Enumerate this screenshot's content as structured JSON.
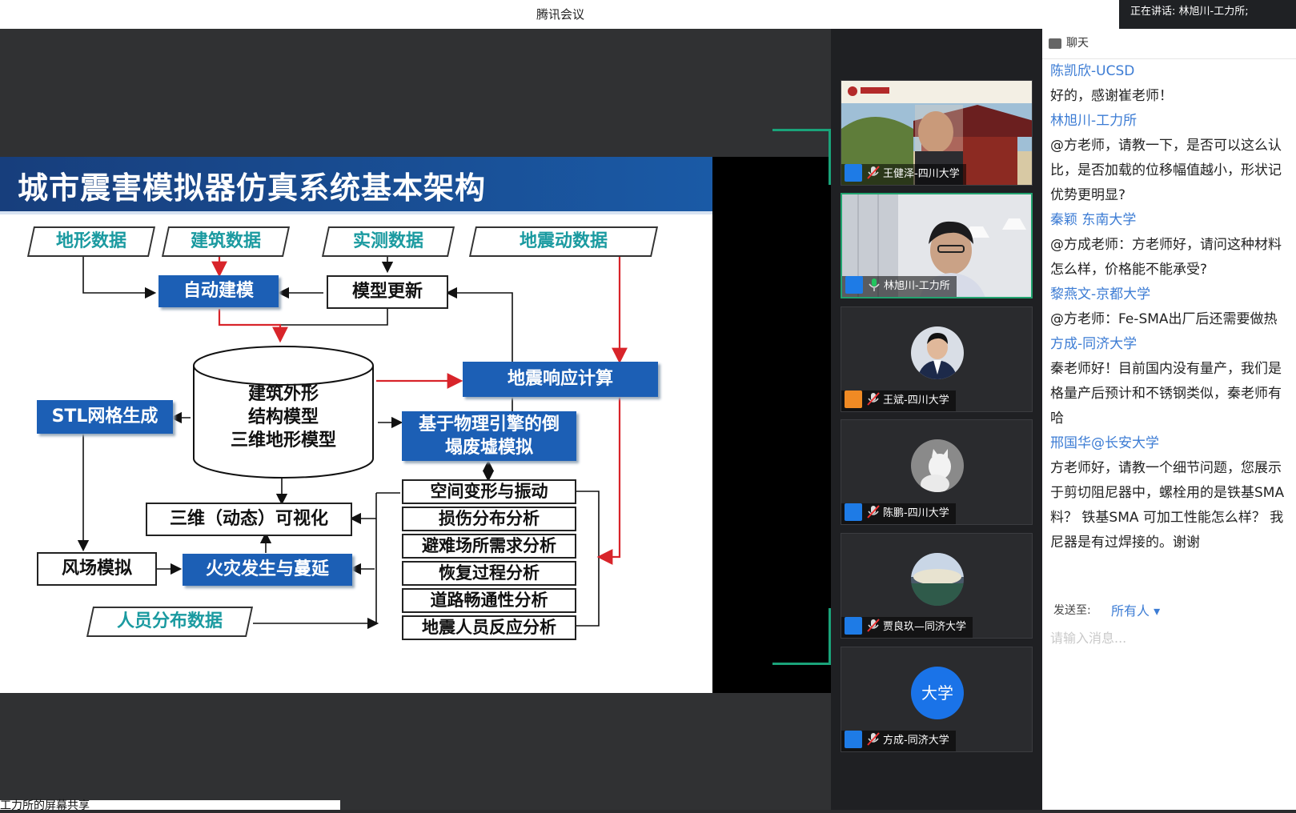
{
  "titlebar": {
    "app_title": "腾讯会议",
    "speaking": "正在讲话: 林旭川-工力所;"
  },
  "slide": {
    "title": "城市震害模拟器仿真系统基本架构",
    "inputs": [
      "地形数据",
      "建筑数据",
      "实测数据",
      "地震动数据"
    ],
    "auto_model": "自动建模",
    "model_update": "模型更新",
    "cylinder_lines": [
      "建筑外形",
      "结构模型",
      "三维地形模型"
    ],
    "seismic_calc": "地震响应计算",
    "stl": "STL网格生成",
    "physics_sim": [
      "基于物理引擎的倒",
      "塌废墟模拟"
    ],
    "visual": "三维（动态）可视化",
    "wind": "风场模拟",
    "fire": "火灾发生与蔓延",
    "people_data": "人员分布数据",
    "analyses": [
      "空间变形与振动",
      "损伤分布分析",
      "避难场所需求分析",
      "恢复过程分析",
      "道路畅通性分析",
      "地震人员反应分析"
    ]
  },
  "bottom_text": "工力所的屏幕共享",
  "participants": [
    {
      "name": "王健泽-四川大学",
      "type": "video-temple",
      "muted": true
    },
    {
      "name": "林旭川-工力所",
      "type": "video-office",
      "muted": false,
      "active": true
    },
    {
      "name": "王斌-四川大学",
      "type": "avatar-suit",
      "muted": true
    },
    {
      "name": "陈鹏-四川大学",
      "type": "avatar-cat",
      "muted": true
    },
    {
      "name": "贾良玖—同济大学",
      "type": "avatar-scene",
      "muted": true
    },
    {
      "name": "方成-同济大学",
      "type": "avatar-text",
      "avatar_text": "大学",
      "muted": true
    }
  ],
  "chat": {
    "header": "聊天",
    "messages": [
      {
        "sender": "陈凯欣-UCSD",
        "lines": [
          "好的，感谢崔老师！"
        ]
      },
      {
        "sender": "林旭川-工力所",
        "lines": [
          "@方老师，请教一下，是否可以这么认",
          "比，是否加载的位移幅值越小，形状记",
          "优势更明显?"
        ]
      },
      {
        "sender": "秦颖 东南大学",
        "lines": [
          "@方成老师：方老师好，请问这种材料",
          "怎么样，价格能不能承受?"
        ]
      },
      {
        "sender": "黎燕文-京都大学",
        "lines": [
          "@方老师：Fe-SMA出厂后还需要做热"
        ]
      },
      {
        "sender": "方成-同济大学",
        "lines": [
          "秦老师好！目前国内没有量产，我们是",
          "格量产后预计和不锈钢类似，秦老师有",
          "哈"
        ]
      },
      {
        "sender": "邢国华@长安大学",
        "lines": [
          "方老师好，请教一个细节问题，您展示",
          "于剪切阻尼器中，螺栓用的是铁基SMA",
          "料？ 铁基SMA 可加工性能怎么样？ 我",
          "尼器是有过焊接的。谢谢"
        ]
      }
    ],
    "send_to_label": "发送至:",
    "send_to_value": "所有人 ▾",
    "input_placeholder": "请输入消息..."
  },
  "colors": {
    "accent_blue": "#1c5fb5",
    "active_green": "#22a36f",
    "chat_name": "#3c7cd4",
    "arrow_red": "#d8242a"
  }
}
